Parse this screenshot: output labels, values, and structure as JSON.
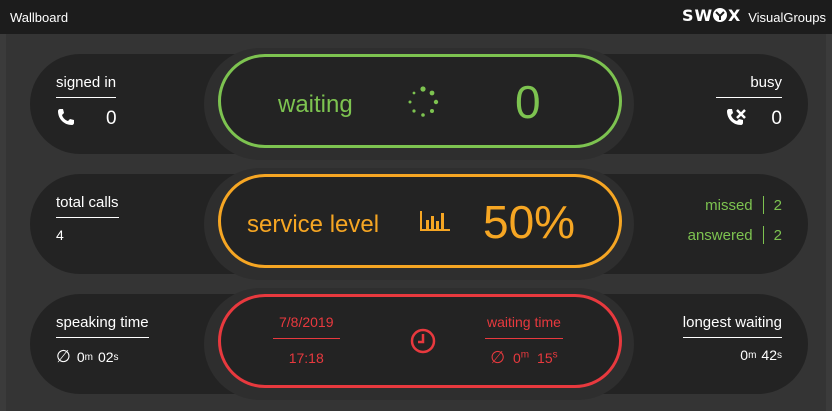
{
  "title_bar": {
    "title": "Wallboard",
    "brand_logo": "SWYX",
    "brand_name": "VisualGroups"
  },
  "colors": {
    "green": "#7dc350",
    "orange": "#f6a623",
    "red": "#e8393e"
  },
  "row1": {
    "signed_in": {
      "label": "signed in",
      "value": "0",
      "icon": "phone-icon"
    },
    "waiting": {
      "label": "waiting",
      "value": "0",
      "icon": "spinner-icon"
    },
    "busy": {
      "label": "busy",
      "value": "0",
      "icon": "phone-busy-icon"
    }
  },
  "row2": {
    "total_calls": {
      "label": "total calls",
      "value": "4"
    },
    "service_level": {
      "label": "service level",
      "value": "50%",
      "icon": "bar-chart-icon"
    },
    "missed": {
      "label": "missed",
      "value": "2"
    },
    "answered": {
      "label": "answered",
      "value": "2"
    }
  },
  "row3": {
    "speaking_time": {
      "label": "speaking time",
      "avg_symbol": "∅",
      "minutes": "0",
      "seconds": "02",
      "m_unit": "m",
      "s_unit": "s"
    },
    "date": "7/8/2019",
    "time": "17:18",
    "clock_icon": "clock-icon",
    "waiting_time": {
      "label": "waiting time",
      "avg_symbol": "∅",
      "minutes": "0",
      "seconds": "15",
      "m_unit": "m",
      "s_unit": "s"
    },
    "longest_waiting": {
      "label": "longest waiting",
      "minutes": "0",
      "seconds": "42",
      "m_unit": "m",
      "s_unit": "s"
    }
  }
}
